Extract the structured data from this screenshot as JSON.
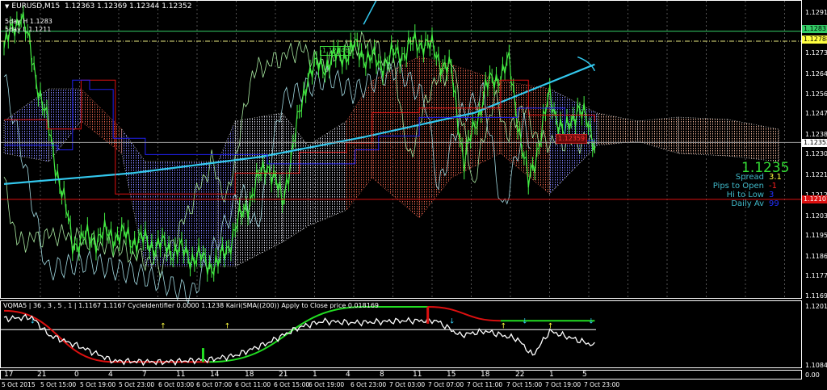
{
  "header": {
    "symbol": "EURUSD,M15",
    "ohlc": "1.12363 1.12369 1.12344 1.12352"
  },
  "levels": {
    "high_label": "5day H 1.1283",
    "low_label": "5day L 1.1211"
  },
  "price_axis": {
    "ticks": [
      "1.12910",
      "1.12735",
      "1.12645",
      "1.12560",
      "1.12475",
      "1.12385",
      "1.12300",
      "1.12210",
      "1.12125",
      "1.12035",
      "1.11950",
      "1.11860",
      "1.11775",
      "1.11690"
    ],
    "tick_values": [
      1.1291,
      1.12735,
      1.12645,
      1.1256,
      1.12475,
      1.12385,
      1.123,
      1.1221,
      1.12125,
      1.12035,
      1.1195,
      1.1186,
      1.11775,
      1.1169
    ],
    "high_box": "1.12831",
    "high_value": 1.12831,
    "yellow_box": "1.12788",
    "yellow_value": 1.12788,
    "bid_box": "1.12352",
    "bid_value": 1.12352,
    "low_box": "1.12107",
    "low_value": 1.12107
  },
  "chart_labels": {
    "green_tag": "1.12746",
    "red_tag": "1.12359"
  },
  "info_panel": {
    "price": "1.1235",
    "rows": [
      {
        "label": "Spread",
        "value": "3.1",
        "color": "#ffff40"
      },
      {
        "label": "Pips to Open",
        "value": "-1",
        "color": "#ff2020"
      },
      {
        "label": "Hi to Low",
        "value": "3",
        "color": "#2030ff"
      },
      {
        "label": "Daily Av",
        "value": "99",
        "color": "#2030ff"
      }
    ]
  },
  "subwindow": {
    "header": "VQMA5 | 36 , 3 , 5 , 1  |  1.1167 1.1167  CycleIdentifier 0.0000 1.1238  Kairi(SMA((200)) Apply to Close price 0.018169",
    "top_label": "1.1201",
    "bottom_label": "1.1084",
    "zero_label": "0.00"
  },
  "time_axis": {
    "hours": [
      "17",
      "21",
      "0",
      "4",
      "7",
      "11",
      "14",
      "18",
      "21",
      "1",
      "4",
      "8",
      "11",
      "15",
      "18",
      "22",
      "1",
      "5"
    ],
    "dates": [
      "5 Oct 2015",
      "5 Oct 15:00",
      "5 Oct 19:00",
      "5 Oct 23:00",
      "6 Oct 03:00",
      "6 Oct 07:00",
      "6 Oct 11:00",
      "6 Oct 15:00",
      "6 Oct 19:00",
      "6 Oct 23:00",
      "7 Oct 03:00",
      "7 Oct 07:00",
      "7 Oct 11:00",
      "7 Oct 15:00",
      "7 Oct 19:00",
      "7 Oct 23:00"
    ]
  },
  "chart_data": {
    "type": "line",
    "x_unit": "M15 bar index",
    "price_range": [
      1.1169,
      1.1291
    ],
    "series": [
      {
        "name": "price",
        "color": "#44ee44",
        "points": [
          [
            0,
            1.12757
          ],
          [
            8,
            1.12913
          ],
          [
            21,
            1.124
          ],
          [
            32,
            1.11923
          ],
          [
            51,
            1.11958
          ],
          [
            81,
            1.11888
          ],
          [
            100,
            1.11819
          ],
          [
            123,
            1.1227
          ],
          [
            130,
            1.12097
          ],
          [
            142,
            1.12653
          ],
          [
            164,
            1.12757
          ],
          [
            175,
            1.12688
          ],
          [
            196,
            1.12792
          ],
          [
            209,
            1.12653
          ],
          [
            215,
            1.1227
          ],
          [
            225,
            1.12583
          ],
          [
            236,
            1.12688
          ],
          [
            245,
            1.12166
          ],
          [
            255,
            1.12549
          ],
          [
            262,
            1.12375
          ],
          [
            268,
            1.12514
          ],
          [
            276,
            1.12357
          ]
        ]
      },
      {
        "name": "sma",
        "color": "#33c8ee",
        "points": [
          [
            0,
            1.12173
          ],
          [
            60,
            1.1222
          ],
          [
            120,
            1.1229
          ],
          [
            168,
            1.12375
          ],
          [
            220,
            1.1248
          ],
          [
            276,
            1.12688
          ]
        ]
      },
      {
        "name": "kijun",
        "color": "#dd1010",
        "points": [
          [
            0,
            1.1245
          ],
          [
            20,
            1.1241
          ],
          [
            36,
            1.1262
          ],
          [
            51,
            1.1262
          ],
          [
            52,
            1.1213
          ],
          [
            100,
            1.1213
          ],
          [
            108,
            1.1222
          ],
          [
            138,
            1.1231
          ],
          [
            160,
            1.1235
          ],
          [
            172,
            1.1248
          ],
          [
            194,
            1.125
          ],
          [
            232,
            1.1262
          ],
          [
            245,
            1.1247
          ],
          [
            276,
            1.1244
          ]
        ]
      },
      {
        "name": "tenkan",
        "color": "#2020ee",
        "points": [
          [
            0,
            1.1234
          ],
          [
            25,
            1.1232
          ],
          [
            32,
            1.1262
          ],
          [
            40,
            1.1258
          ],
          [
            51,
            1.1237
          ],
          [
            66,
            1.123
          ],
          [
            100,
            1.123
          ],
          [
            123,
            1.1226
          ],
          [
            149,
            1.1226
          ],
          [
            164,
            1.1232
          ],
          [
            175,
            1.1238
          ],
          [
            194,
            1.1246
          ],
          [
            240,
            1.125
          ],
          [
            262,
            1.1236
          ],
          [
            276,
            1.1236
          ]
        ]
      }
    ],
    "cloud": [
      {
        "bar": 0,
        "a": 1.12444,
        "b": 1.12305,
        "kind": "bull"
      },
      {
        "bar": 21,
        "a": 1.12583,
        "b": 1.1227,
        "kind": "bull"
      },
      {
        "bar": 36,
        "a": 1.12583,
        "b": 1.12444,
        "kind": "bear"
      },
      {
        "bar": 55,
        "a": 1.12409,
        "b": 1.12305,
        "kind": "bull"
      },
      {
        "bar": 66,
        "a": 1.1227,
        "b": 1.11818,
        "kind": "bull"
      },
      {
        "bar": 100,
        "a": 1.1227,
        "b": 1.11818,
        "kind": "bull"
      },
      {
        "bar": 108,
        "a": 1.12444,
        "b": 1.11818,
        "kind": "white"
      },
      {
        "bar": 130,
        "a": 1.12479,
        "b": 1.11922,
        "kind": "white"
      },
      {
        "bar": 142,
        "a": 1.12339,
        "b": 1.11992,
        "kind": "white"
      },
      {
        "bar": 160,
        "a": 1.12444,
        "b": 1.12061,
        "kind": "bear"
      },
      {
        "bar": 172,
        "a": 1.12618,
        "b": 1.122,
        "kind": "bear"
      },
      {
        "bar": 194,
        "a": 1.12722,
        "b": 1.12027,
        "kind": "bear"
      },
      {
        "bar": 209,
        "a": 1.12687,
        "b": 1.122,
        "kind": "bear"
      },
      {
        "bar": 232,
        "a": 1.12618,
        "b": 1.12305,
        "kind": "bear"
      },
      {
        "bar": 255,
        "a": 1.12583,
        "b": 1.12131,
        "kind": "bull"
      },
      {
        "bar": 277,
        "a": 1.12479,
        "b": 1.12339,
        "kind": "peach"
      },
      {
        "bar": 296,
        "a": 1.12444,
        "b": 1.12357,
        "kind": "peach"
      },
      {
        "bar": 315,
        "a": 1.12461,
        "b": 1.12305,
        "kind": "peach"
      },
      {
        "bar": 338,
        "a": 1.12451,
        "b": 1.12294,
        "kind": "peach"
      },
      {
        "bar": 362,
        "a": 1.12409,
        "b": 1.1227,
        "kind": "peach"
      }
    ],
    "oscillator": {
      "range": [
        1.1084,
        1.1201
      ],
      "white": [
        [
          0,
          1.1177
        ],
        [
          13,
          1.118
        ],
        [
          21,
          1.1144
        ],
        [
          36,
          1.112
        ],
        [
          51,
          1.1092
        ],
        [
          74,
          1.109
        ],
        [
          96,
          1.1095
        ],
        [
          108,
          1.1103
        ],
        [
          123,
          1.1128
        ],
        [
          138,
          1.116
        ],
        [
          149,
          1.1172
        ],
        [
          164,
          1.1169
        ],
        [
          187,
          1.1173
        ],
        [
          202,
          1.1173
        ],
        [
          213,
          1.1144
        ],
        [
          225,
          1.1152
        ],
        [
          240,
          1.1136
        ],
        [
          247,
          1.1103
        ],
        [
          255,
          1.1152
        ],
        [
          276,
          1.1123
        ]
      ],
      "signal": [
        [
          0,
          1.1193,
          "red"
        ],
        [
          51,
          1.109,
          "red"
        ],
        [
          96,
          1.109,
          "green"
        ],
        [
          168,
          1.1201,
          "green"
        ],
        [
          198,
          1.1201,
          "red"
        ],
        [
          232,
          1.1173,
          "green"
        ],
        [
          276,
          1.1173,
          "green"
        ]
      ],
      "level": 1.1155
    }
  }
}
